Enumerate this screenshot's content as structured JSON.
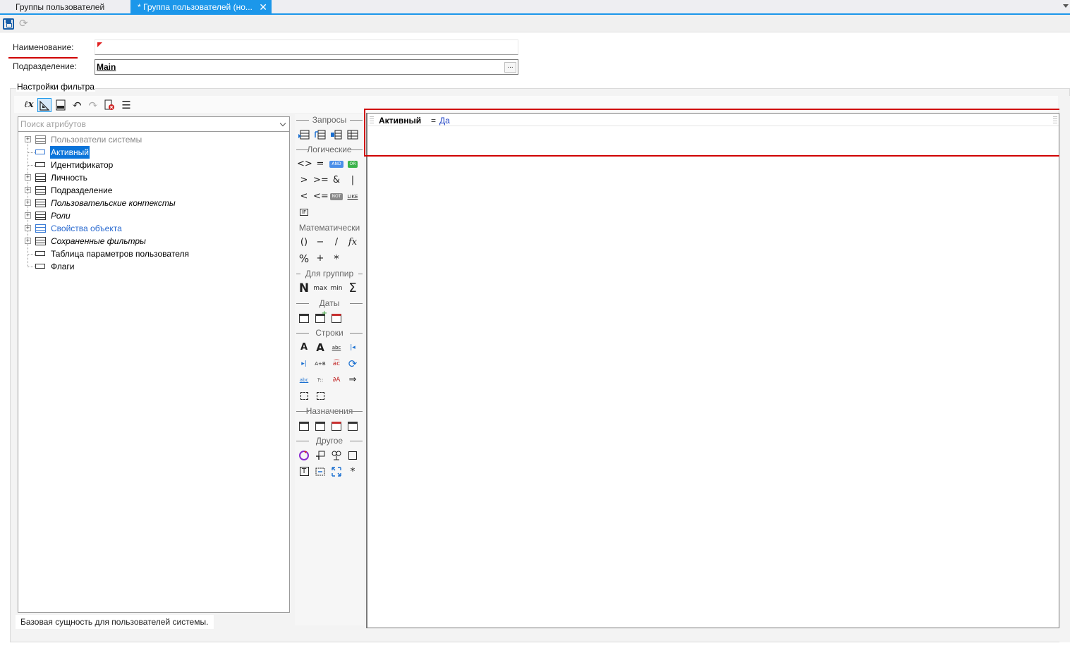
{
  "tabs": [
    {
      "label": "Группы пользователей",
      "active": false
    },
    {
      "label": "* Группа пользователей (но...",
      "active": true
    }
  ],
  "tab_close_glyph": "✕",
  "toolbar": {
    "save_icon": "save-icon",
    "refresh_icon": "refresh-icon"
  },
  "form": {
    "name_label": "Наименование:",
    "name_value": "",
    "dept_label": "Подразделение:",
    "dept_value": "Main",
    "dept_button": "..."
  },
  "filter": {
    "group_title": "Настройки фильтра",
    "toolbar_icons": [
      "lambda-icon",
      "designer-icon",
      "sql-icon",
      "undo-icon",
      "redo-icon",
      "clear-filter-icon",
      "list-icon"
    ],
    "toolbar_glyphs": {
      "lambda": "ℓx",
      "undo": "↶",
      "redo": "↷",
      "list": "☰"
    },
    "search_placeholder": "Поиск атрибутов",
    "tree": [
      {
        "label": "Пользователи системы",
        "style": "grey",
        "icon": "table"
      },
      {
        "label": "Активный",
        "style": "selected",
        "icon": "field"
      },
      {
        "label": "Идентификатор",
        "style": "normal",
        "icon": "field"
      },
      {
        "label": "Личность",
        "style": "normal",
        "icon": "table"
      },
      {
        "label": "Подразделение",
        "style": "normal",
        "icon": "table"
      },
      {
        "label": "Пользовательские контексты",
        "style": "italic",
        "icon": "table"
      },
      {
        "label": "Роли",
        "style": "italic",
        "icon": "table"
      },
      {
        "label": "Свойства объекта",
        "style": "blue",
        "icon": "table"
      },
      {
        "label": "Сохраненные фильтры",
        "style": "italic",
        "icon": "table"
      },
      {
        "label": "Таблица параметров пользователя",
        "style": "normal",
        "icon": "field"
      },
      {
        "label": "Флаги",
        "style": "normal",
        "icon": "field"
      }
    ],
    "status": "Базовая сущность для пользователей системы.",
    "palette": {
      "sections": [
        "Запросы",
        "Логические",
        "Математически",
        "Для группир",
        "Даты",
        "Строки",
        "Назначения",
        "Другое"
      ],
      "logic_ops": [
        "<>",
        "=",
        "AND",
        "OR",
        ">",
        ">=",
        "&",
        "|",
        "<",
        "<=",
        "NOT",
        "LIKE",
        "IF"
      ],
      "math_ops": [
        "()",
        "−",
        "/",
        "fx",
        "%",
        "+",
        "*"
      ],
      "group_ops": [
        "N",
        "max",
        "min",
        "Σ"
      ],
      "string_ops": [
        "A",
        "A",
        "abc",
        "|◂",
        "▸|",
        "A+B",
        "a͡c",
        "⟳",
        "abc",
        "?::",
        "∂A",
        "⇒"
      ],
      "other_ops": [
        "T",
        "*"
      ]
    },
    "expression": {
      "attribute": "Активный",
      "operator": "=",
      "value": "Да"
    }
  }
}
